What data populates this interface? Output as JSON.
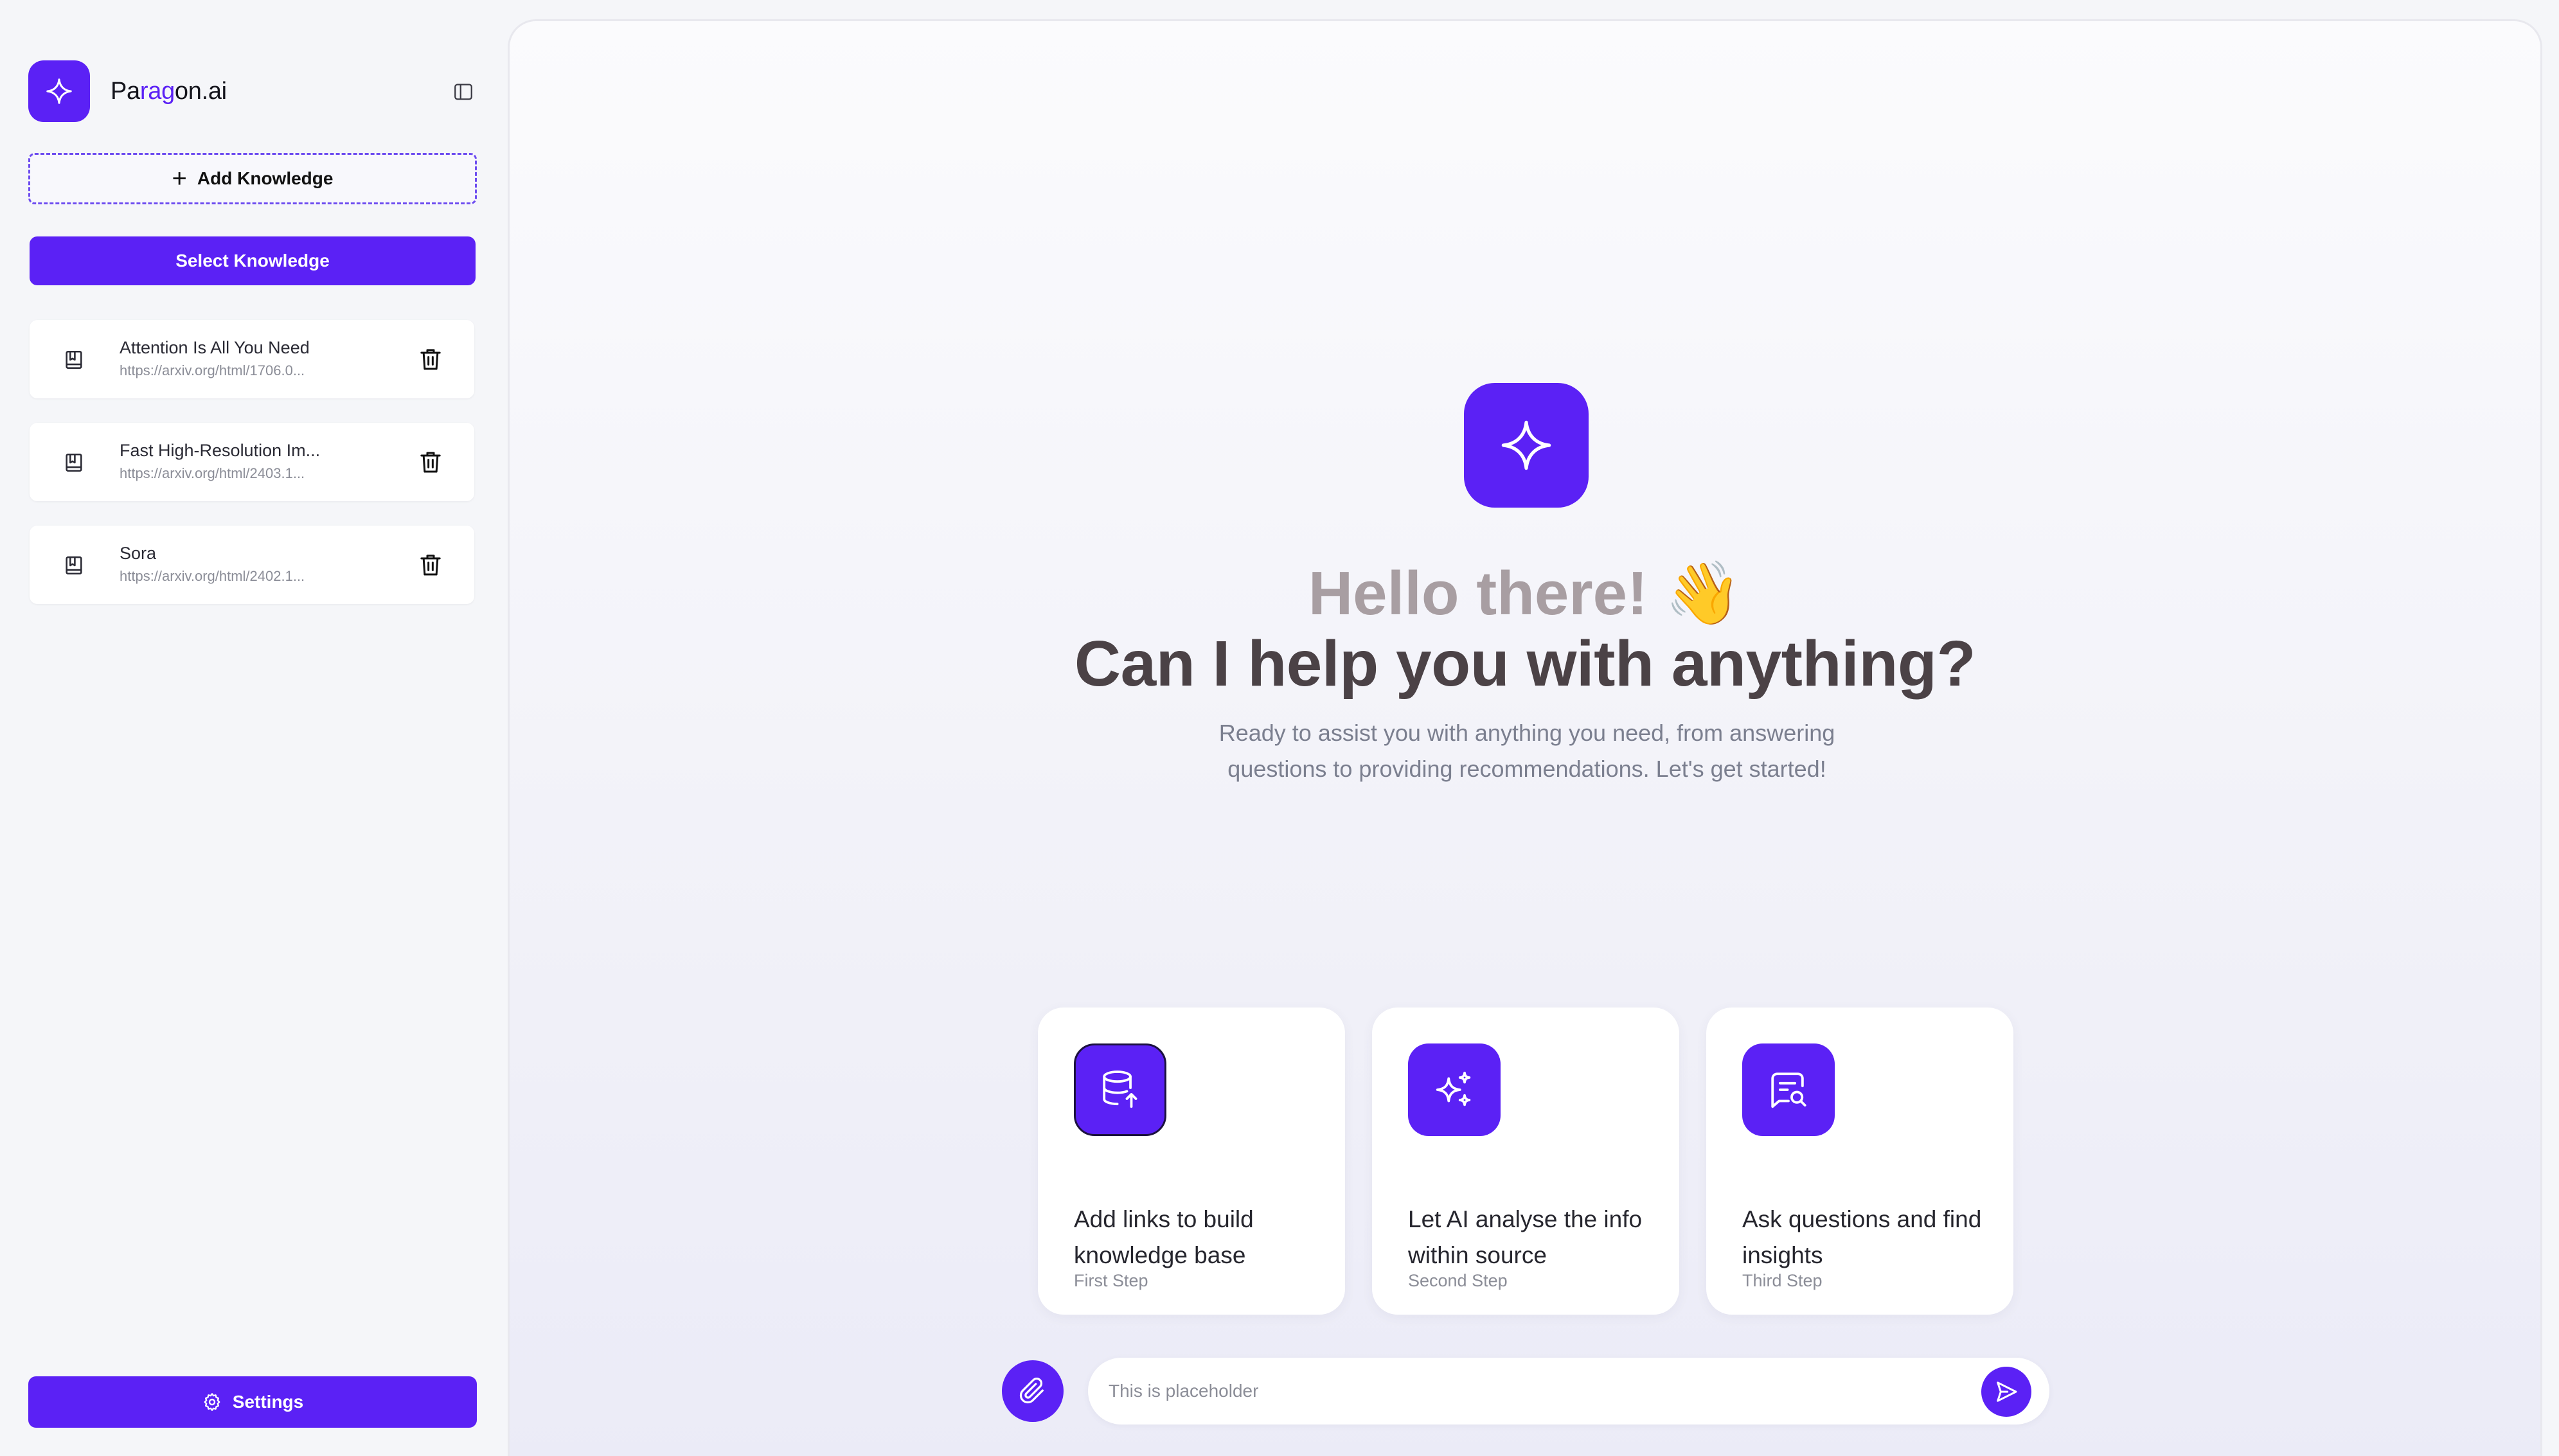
{
  "brand": {
    "name_prefix": "Pa",
    "name_accent": "rag",
    "name_suffix": "on.ai",
    "accent_color": "#5b21f5"
  },
  "sidebar": {
    "add_knowledge_label": "Add Knowledge",
    "select_knowledge_label": "Select Knowledge",
    "knowledge_items": [
      {
        "title": "Attention Is All You Need",
        "url": "https://arxiv.org/html/1706.0..."
      },
      {
        "title": "Fast High-Resolution Im...",
        "url": "https://arxiv.org/html/2403.1..."
      },
      {
        "title": "Sora",
        "url": "https://arxiv.org/html/2402.1..."
      }
    ],
    "settings_label": "Settings"
  },
  "main": {
    "greeting": "Hello there! 👋",
    "headline": "Can I help you with anything?",
    "subtitle": "Ready to assist you with anything you need, from answering questions to providing recommendations. Let's get started!",
    "cards": [
      {
        "title": "Add links to build knowledge base",
        "step": "First Step",
        "icon": "database-upload-icon"
      },
      {
        "title": "Let AI analyse the info within source",
        "step": "Second Step",
        "icon": "sparkles-icon"
      },
      {
        "title": "Ask questions and find insights",
        "step": "Third Step",
        "icon": "message-search-icon"
      }
    ]
  },
  "chat": {
    "placeholder": "This is placeholder"
  }
}
